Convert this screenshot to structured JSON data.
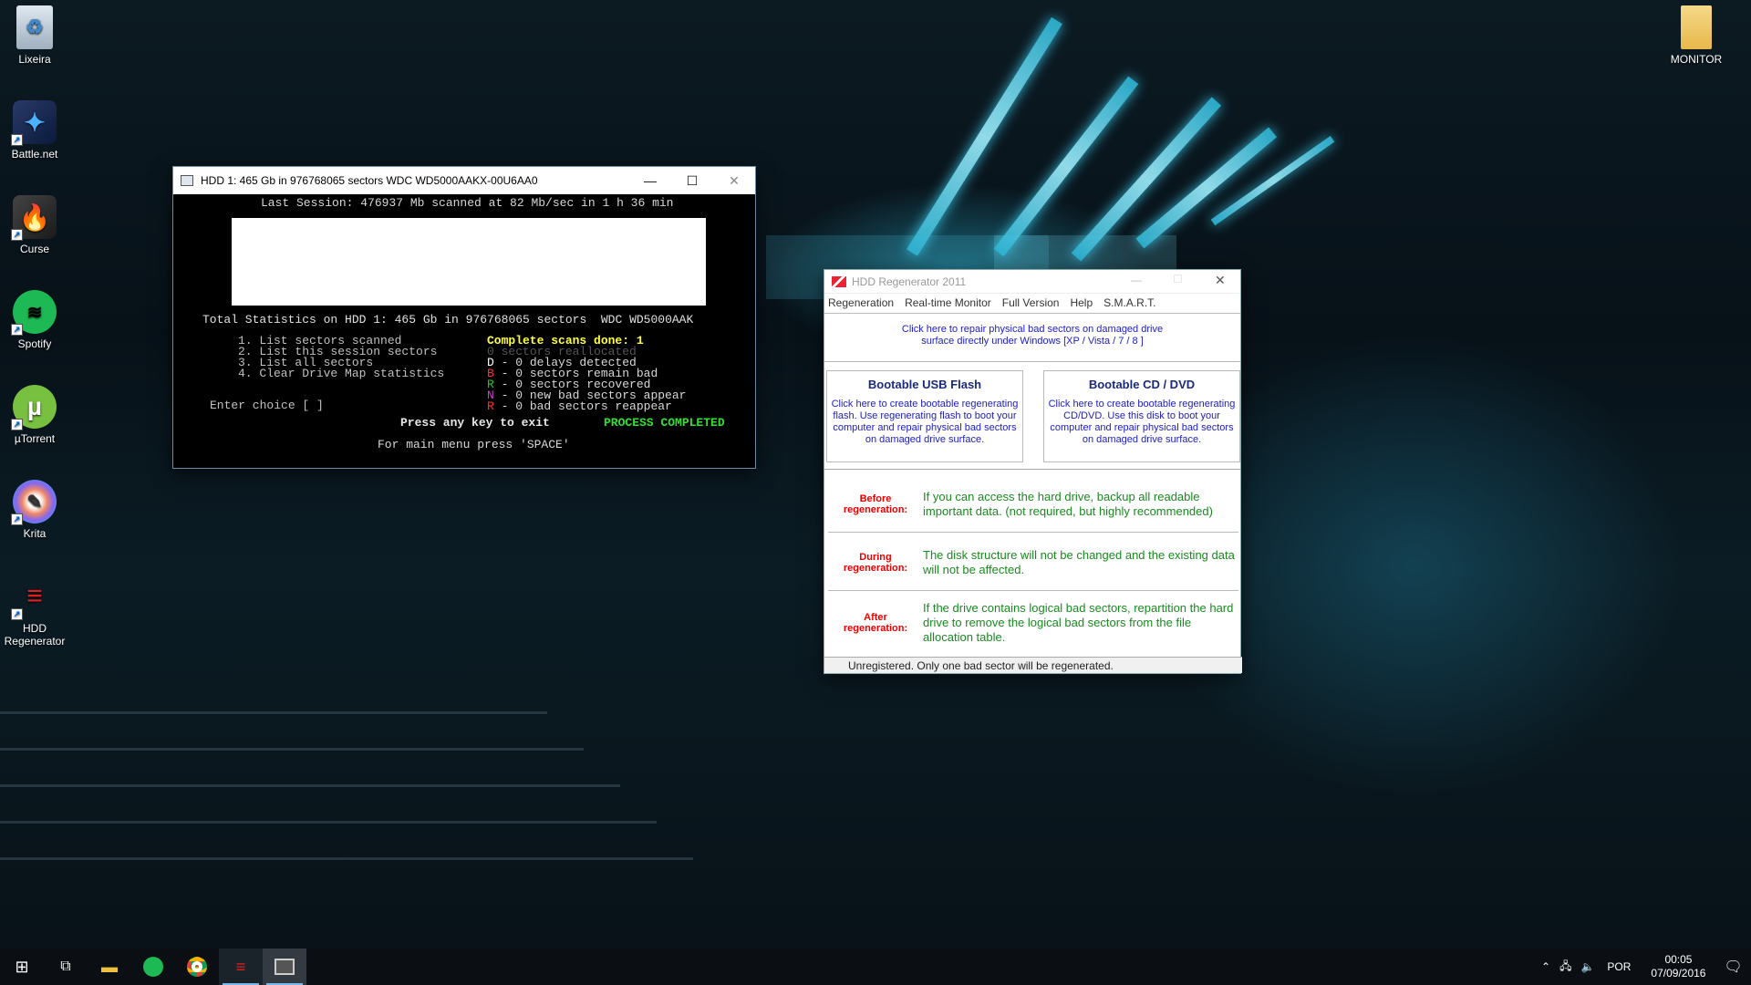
{
  "desktop": {
    "icons": [
      {
        "label": "Lixeira",
        "icon": "recycle-bin-icon"
      },
      {
        "label": "Battle.net",
        "icon": "battlenet-icon"
      },
      {
        "label": "Curse",
        "icon": "curse-icon"
      },
      {
        "label": "Spotify",
        "icon": "spotify-icon"
      },
      {
        "label": "µTorrent",
        "icon": "utorrent-icon"
      },
      {
        "label": "Krita",
        "icon": "krita-icon"
      },
      {
        "label": "HDD\nRegenerator",
        "icon": "hdd-regenerator-icon"
      },
      {
        "label": "MONITOR",
        "icon": "folder-icon"
      }
    ]
  },
  "console": {
    "title": "HDD 1: 465 Gb in 976768065 sectors  WDC WD5000AAKX-00U6AA0",
    "last_session": "Last Session: 476937 Mb scanned at 82 Mb/sec in 1 h 36 min",
    "total_stats": "Total Statistics on HDD 1: 465 Gb in 976768065 sectors  WDC WD5000AAK",
    "menu": [
      "1. List sectors scanned",
      "2. List this session sectors",
      "3. List all sectors",
      "4. Clear Drive Map statistics"
    ],
    "complete_scans": "Complete scans done: 1",
    "stats": [
      {
        "code": "0",
        "text": " sectors reallocated",
        "color": "#555555"
      },
      {
        "code": "D",
        "text": " - 0 delays detected",
        "color": "#ffffff"
      },
      {
        "code": "B",
        "text": " - 0 sectors remain bad",
        "color": "#ff3030"
      },
      {
        "code": "R",
        "text": " - 0 sectors recovered",
        "color": "#30c030"
      },
      {
        "code": "N",
        "text": " - 0 new bad sectors appear",
        "color": "#d040d0"
      },
      {
        "code": "R",
        "text": " - 0 bad sectors reappear",
        "color": "#ff3030"
      }
    ],
    "enter_choice": "Enter choice [ ]",
    "press_exit": "Press any key to exit",
    "process_completed": "PROCESS COMPLETED",
    "main_menu": "For main menu press 'SPACE'"
  },
  "dialog": {
    "title": "HDD Regenerator 2011",
    "menu": [
      "Regeneration",
      "Real-time Monitor",
      "Full Version",
      "Help",
      "S.M.A.R.T."
    ],
    "repair_link": "Click here to repair physical bad sectors on damaged drive\nsurface directly under Windows  [XP / Vista / 7 / 8 ]",
    "usb": {
      "title": "Bootable USB Flash",
      "text": "Click here to create bootable regenerating flash. Use regenerating flash to boot your computer and repair physical bad sectors on damaged drive surface."
    },
    "cd": {
      "title": "Bootable CD / DVD",
      "text": "Click here to create bootable regenerating CD/DVD. Use this disk to boot your computer and repair physical bad sectors on damaged drive surface."
    },
    "rows": [
      {
        "label": "Before\nregeneration:",
        "text": "If you can access the hard drive, backup all readable important data. (not required, but highly recommended)"
      },
      {
        "label": "During\nregeneration:",
        "text": "The disk structure will not be changed and the existing data will not be affected."
      },
      {
        "label": "After\nregeneration:",
        "text": "If the drive contains logical bad sectors, repartition the hard drive to remove the logical bad sectors from the file allocation table."
      }
    ],
    "status": "Unregistered. Only one bad sector will be regenerated."
  },
  "taskbar": {
    "lang": "POR",
    "time": "00:05",
    "date": "07/09/2016",
    "apps": [
      "windows-start-icon",
      "task-view-icon",
      "file-explorer-icon",
      "spotify-icon",
      "chrome-icon",
      "hdd-regenerator-icon",
      "console-icon"
    ]
  }
}
